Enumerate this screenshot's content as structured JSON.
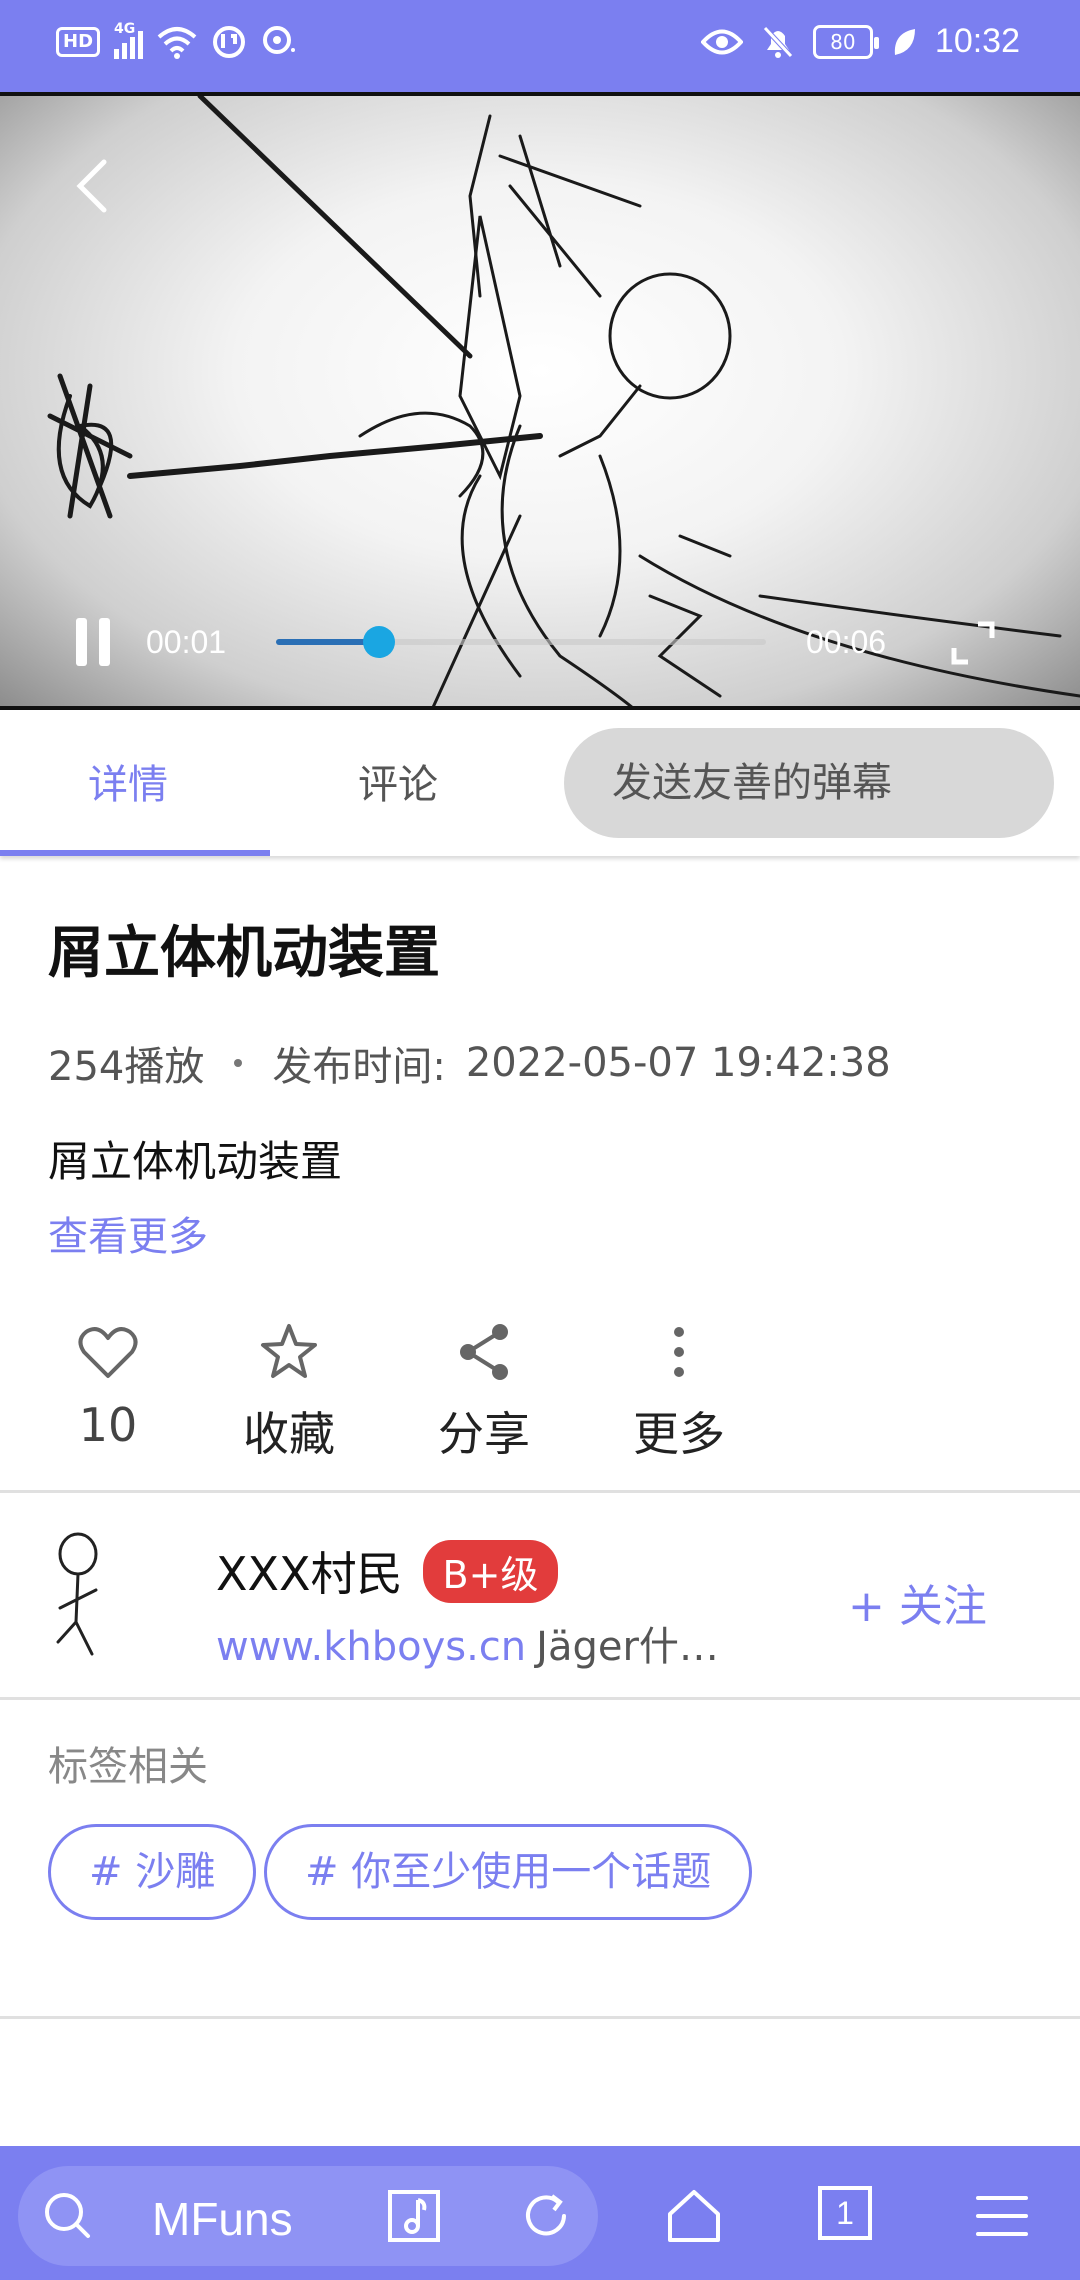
{
  "status_bar": {
    "hd": "HD",
    "network": "4G",
    "battery": "80",
    "time": "10:32"
  },
  "video": {
    "current_time": "00:01",
    "total_time": "00:06",
    "progress": 0.21
  },
  "tabs": [
    {
      "label": "详情",
      "active": true
    },
    {
      "label": "评论",
      "active": false
    }
  ],
  "danmaku_placeholder": "发送友善的弹幕",
  "detail": {
    "title": "屑立体机动装置",
    "plays": "254播放",
    "publish_label": "发布时间:",
    "publish_time": "2022-05-07 19:42:38",
    "description": "屑立体机动装置",
    "more_link": "查看更多"
  },
  "actions": {
    "like": "10",
    "favorite": "收藏",
    "share": "分享",
    "more": "更多"
  },
  "author": {
    "name": "XXX村民",
    "level": "B+级",
    "site": "www.khboys.cn",
    "bio": "Jäger什…",
    "follow": "+ 关注"
  },
  "tags": {
    "title": "标签相关",
    "items": [
      "# 沙雕",
      "# 你至少使用一个话题"
    ]
  },
  "bottom_bar": {
    "search_text": "MFuns",
    "tab_count": "1"
  },
  "colors": {
    "accent": "#7b7ff0",
    "level_badge": "#e23c3c",
    "progress_fill": "#2a6fb5",
    "progress_knob": "#1aa6e2"
  }
}
